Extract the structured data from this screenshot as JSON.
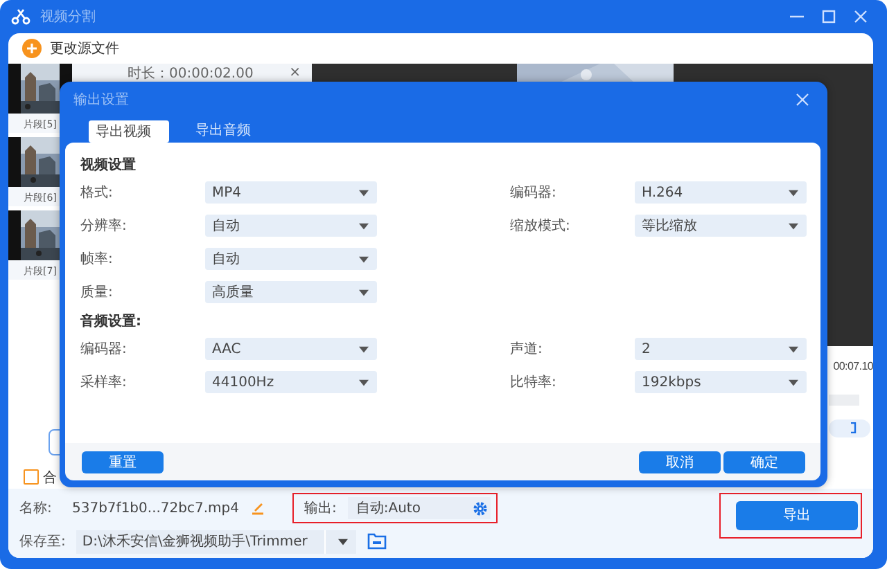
{
  "window": {
    "title": "视频分割"
  },
  "toolbar": {
    "change_source": "更改源文件"
  },
  "clips": [
    {
      "label": "片段[5]"
    },
    {
      "label": "片段[6]"
    },
    {
      "label": "片段[7]"
    }
  ],
  "clip_info": {
    "duration": "时长：00:00:02.00",
    "close": "×"
  },
  "preview": {
    "time": "00:07.10"
  },
  "merge": {
    "label": "合",
    "checked": false
  },
  "file": {
    "name_label": "名称:",
    "name": "537b7f1b0...72bc7.mp4",
    "output_label": "输出:",
    "output_value": "自动:Auto",
    "output_highlighted": true,
    "save_label": "保存至:",
    "save_path": "D:\\沐禾安信\\金狮视频助手\\Trimmer"
  },
  "export_button": {
    "label": "导出",
    "highlighted": true
  },
  "dialog": {
    "title": "输出设置",
    "tabs": [
      {
        "label": "导出视频",
        "selected": true
      },
      {
        "label": "导出音频",
        "selected": false
      }
    ],
    "sections": [
      {
        "title": "视频设置",
        "rows": [
          [
            {
              "label": "格式:",
              "value": "MP4"
            },
            {
              "label": "编码器:",
              "value": "H.264"
            }
          ],
          [
            {
              "label": "分辨率:",
              "value": "自动"
            },
            {
              "label": "缩放模式:",
              "value": "等比缩放"
            }
          ],
          [
            {
              "label": "帧率:",
              "value": "自动"
            }
          ],
          [
            {
              "label": "质量:",
              "value": "高质量"
            }
          ]
        ]
      },
      {
        "title": "音频设置:",
        "rows": [
          [
            {
              "label": "编码器:",
              "value": "AAC"
            },
            {
              "label": "声道:",
              "value": "2"
            }
          ],
          [
            {
              "label": "采样率:",
              "value": "44100Hz"
            },
            {
              "label": "比特率:",
              "value": "192kbps"
            }
          ]
        ]
      }
    ],
    "buttons": {
      "reset": "重置",
      "cancel": "取消",
      "ok": "确定"
    }
  }
}
